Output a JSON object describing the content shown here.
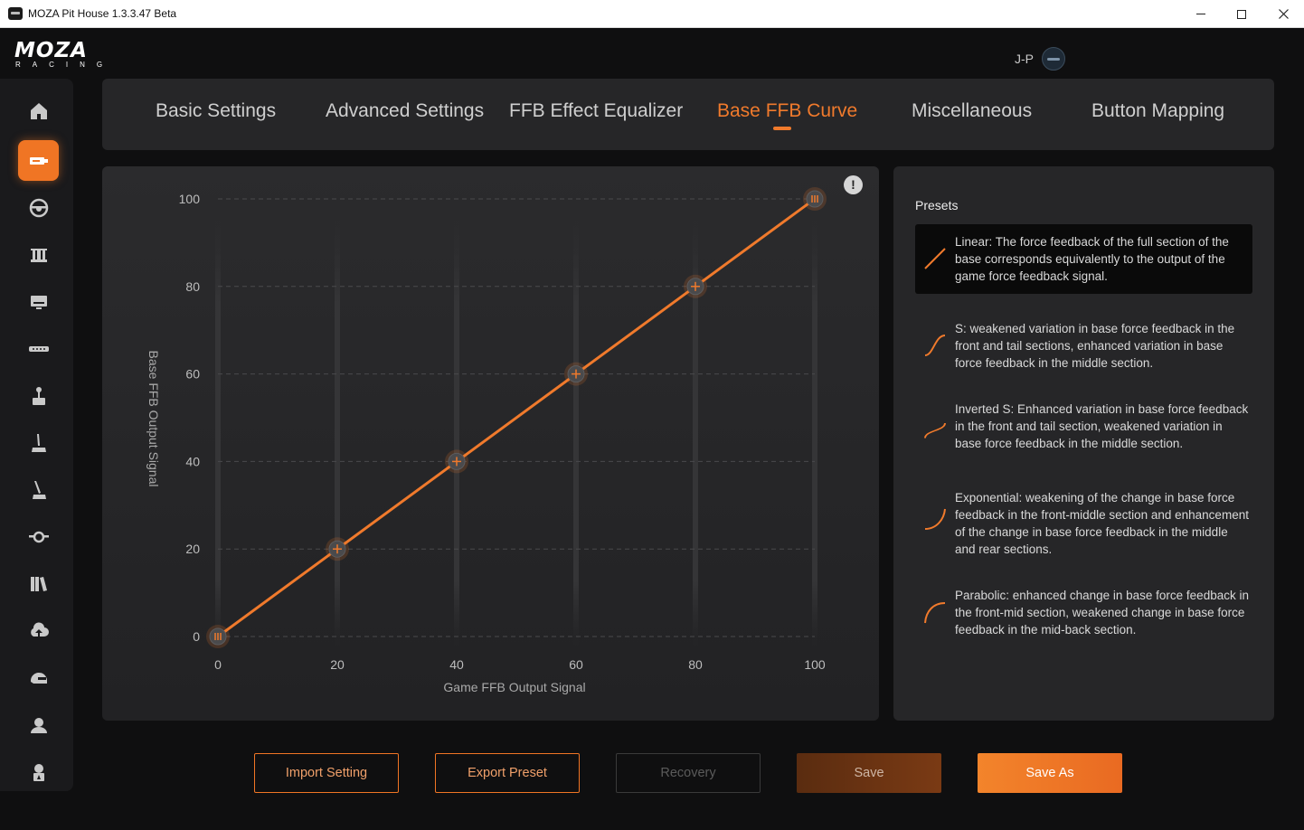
{
  "window": {
    "title": "MOZA Pit House 1.3.3.47 Beta"
  },
  "logo": {
    "line1": "MOZA",
    "line2": "RACING"
  },
  "user": {
    "name": "J-P"
  },
  "sidebar": {
    "items": [
      {
        "icon": "home-icon"
      },
      {
        "icon": "wheelbase-icon",
        "active": true
      },
      {
        "icon": "steering-wheel-icon"
      },
      {
        "icon": "pedals-icon"
      },
      {
        "icon": "dashboard-display-icon"
      },
      {
        "icon": "rpm-bar-icon"
      },
      {
        "icon": "shifter-icon"
      },
      {
        "icon": "handbrake-icon"
      },
      {
        "icon": "sequential-shifter-icon"
      },
      {
        "icon": "hub-icon"
      },
      {
        "icon": "library-icon"
      },
      {
        "icon": "cloud-upload-icon"
      },
      {
        "icon": "helmet-icon"
      },
      {
        "icon": "profile-icon"
      },
      {
        "icon": "support-icon"
      }
    ]
  },
  "tabs": [
    {
      "label": "Basic Settings"
    },
    {
      "label": "Advanced Settings"
    },
    {
      "label": "FFB Effect Equalizer"
    },
    {
      "label": "Base FFB Curve",
      "active": true
    },
    {
      "label": "Miscellaneous"
    },
    {
      "label": "Button Mapping"
    }
  ],
  "chart_data": {
    "type": "line",
    "x": [
      0,
      20,
      40,
      60,
      80,
      100
    ],
    "series": [
      {
        "values": [
          0,
          20,
          40,
          60,
          80,
          100
        ]
      }
    ],
    "xlabel": "Game FFB Output Signal",
    "ylabel": "Base FFB Output Signal",
    "xlim": [
      0,
      100
    ],
    "ylim": [
      0,
      100
    ],
    "xticks": [
      "0",
      "20",
      "40",
      "60",
      "80",
      "100"
    ],
    "yticks": [
      "0",
      "20",
      "40",
      "60",
      "80",
      "100"
    ],
    "grid": "horizontal dashed",
    "line_color": "#f07a2c"
  },
  "info": {
    "label": "!"
  },
  "presets": {
    "title": "Presets",
    "items": [
      {
        "name": "linear",
        "text": "Linear: The force feedback of the full section of the base corresponds equivalently to the output of the game force feedback signal.",
        "active": true
      },
      {
        "name": "s-curve",
        "text": "S: weakened variation in base force feedback in the front and tail sections, enhanced variation in base force feedback in the middle section."
      },
      {
        "name": "inverted-s",
        "text": "Inverted S: Enhanced variation in base force feedback in the front and tail section, weakened variation in base force feedback in the middle section."
      },
      {
        "name": "exponential",
        "text": "Exponential: weakening of the change in base force feedback in the front-middle section and enhancement of the change in base force feedback in the middle and rear sections."
      },
      {
        "name": "parabolic",
        "text": "Parabolic: enhanced change in base force feedback in the front-mid section, weakened change in base force feedback in the mid-back section."
      }
    ]
  },
  "buttons": {
    "import": "Import Setting",
    "export": "Export Preset",
    "recovery": "Recovery",
    "save": "Save",
    "save_as": "Save As"
  }
}
